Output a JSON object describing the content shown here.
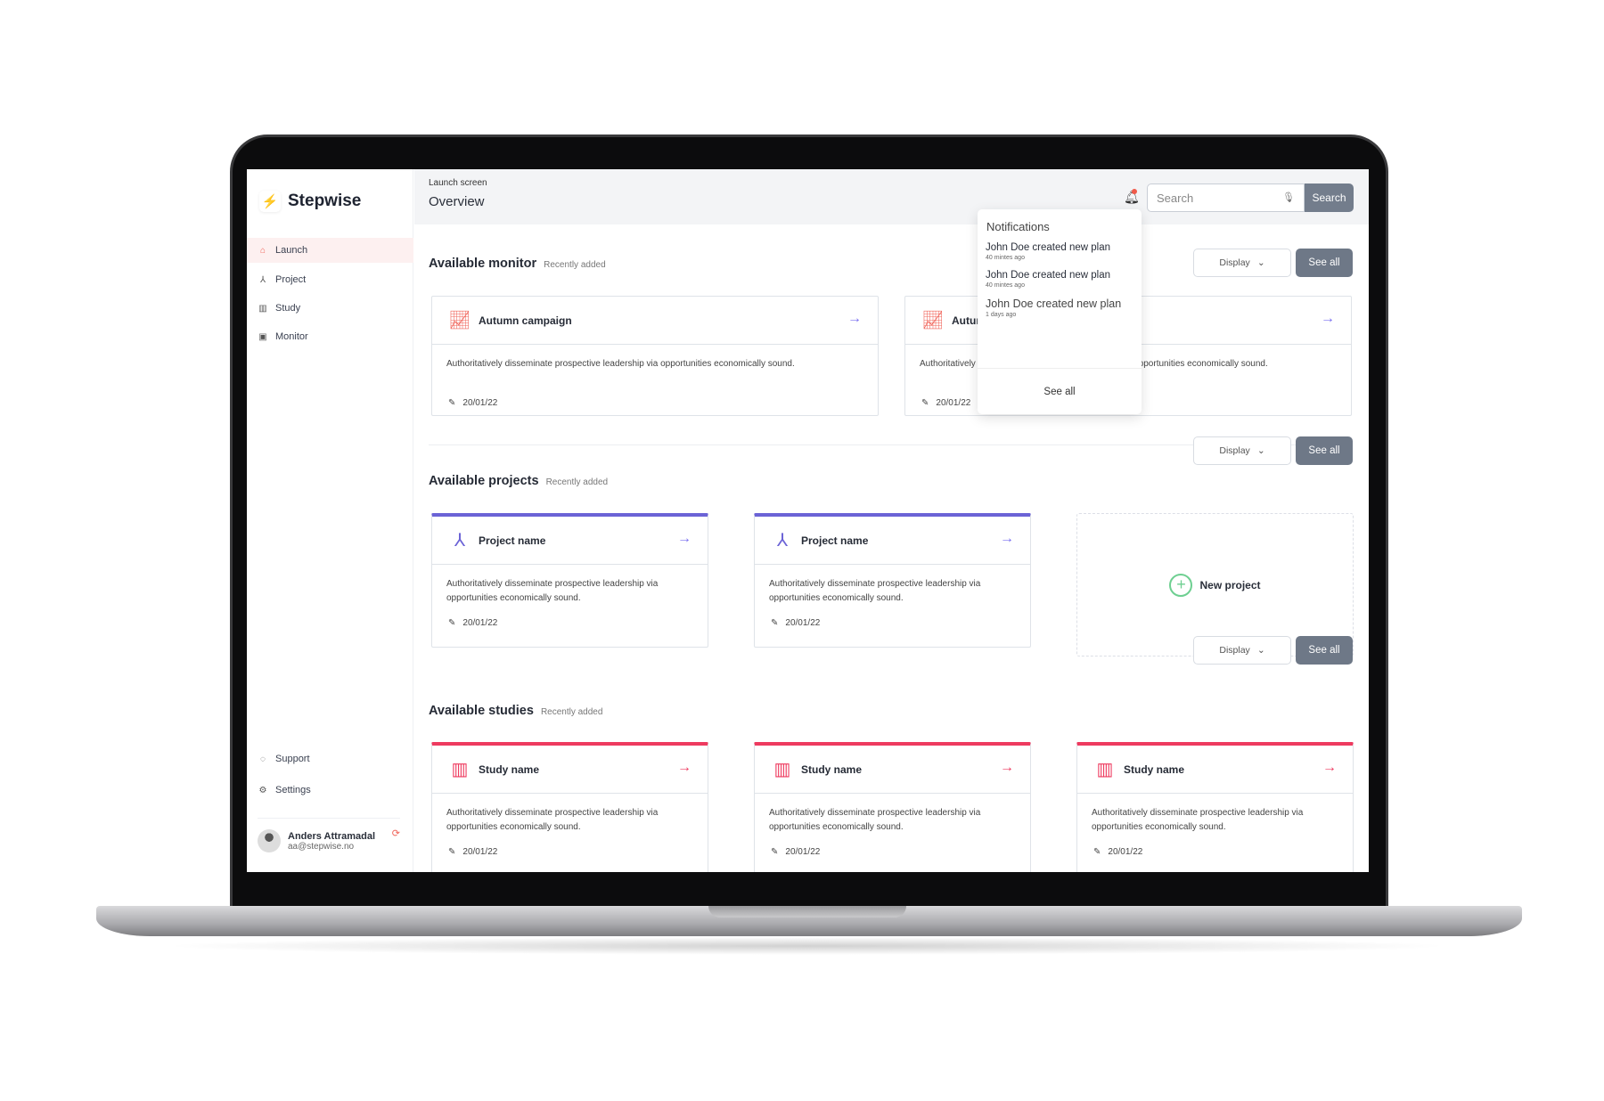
{
  "brand": {
    "name": "Stepwise"
  },
  "sidebar": {
    "items": [
      {
        "label": "Launch",
        "icon": "home-icon"
      },
      {
        "label": "Project",
        "icon": "project-icon"
      },
      {
        "label": "Study",
        "icon": "chart-icon"
      },
      {
        "label": "Monitor",
        "icon": "monitor-icon"
      }
    ],
    "support": "Support",
    "settings": "Settings",
    "user": {
      "name": "Anders Attramadal",
      "email": "aa@stepwise.no"
    }
  },
  "header": {
    "breadcrumb": "Launch screen",
    "title": "Overview",
    "search_placeholder": "Search",
    "search_button": "Search"
  },
  "notifications": {
    "title": "Notifications",
    "items": [
      {
        "text": "John Doe created new plan",
        "time": "40 mintes ago"
      },
      {
        "text": "John Doe created new plan",
        "time": "40 mintes ago"
      },
      {
        "text": "John Doe created new plan",
        "time": "1 days ago"
      }
    ],
    "see_all": "See all"
  },
  "sections": [
    {
      "title": "Available monitor",
      "subtitle": "Recently added",
      "display": "Display",
      "see_all": "See all",
      "color": "#f0645a",
      "arrow_color": "#7a6ff0",
      "cards": [
        {
          "title": "Autumn campaign",
          "desc": "Authoritatively disseminate prospective leadership via opportunities economically sound.",
          "date": "20/01/22"
        },
        {
          "title": "Autumn campaign",
          "desc": "Authoritatively disseminate prospective leadership via opportunities economically sound.",
          "date": "20/01/22"
        }
      ]
    },
    {
      "title": "Available projects",
      "subtitle": "Recently added",
      "display": "Display",
      "see_all": "See all",
      "color": "#6b63d6",
      "arrow_color": "#7a6ff0",
      "new_label": "New project",
      "cards": [
        {
          "title": "Project name",
          "desc": "Authoritatively disseminate prospective leadership via opportunities economically sound.",
          "date": "20/01/22"
        },
        {
          "title": "Project name",
          "desc": "Authoritatively disseminate prospective leadership via opportunities economically sound.",
          "date": "20/01/22"
        }
      ]
    },
    {
      "title": "Available studies",
      "subtitle": "Recently added",
      "display": "Display",
      "see_all": "See all",
      "color": "#ee3a5f",
      "arrow_color": "#ee3a5f",
      "cards": [
        {
          "title": "Study name",
          "desc": "Authoritatively disseminate prospective leadership via opportunities economically sound.",
          "date": "20/01/22"
        },
        {
          "title": "Study name",
          "desc": "Authoritatively disseminate prospective leadership via opportunities economically sound.",
          "date": "20/01/22"
        },
        {
          "title": "Study name",
          "desc": "Authoritatively disseminate prospective leadership via opportunities economically sound.",
          "date": "20/01/22"
        }
      ]
    }
  ]
}
